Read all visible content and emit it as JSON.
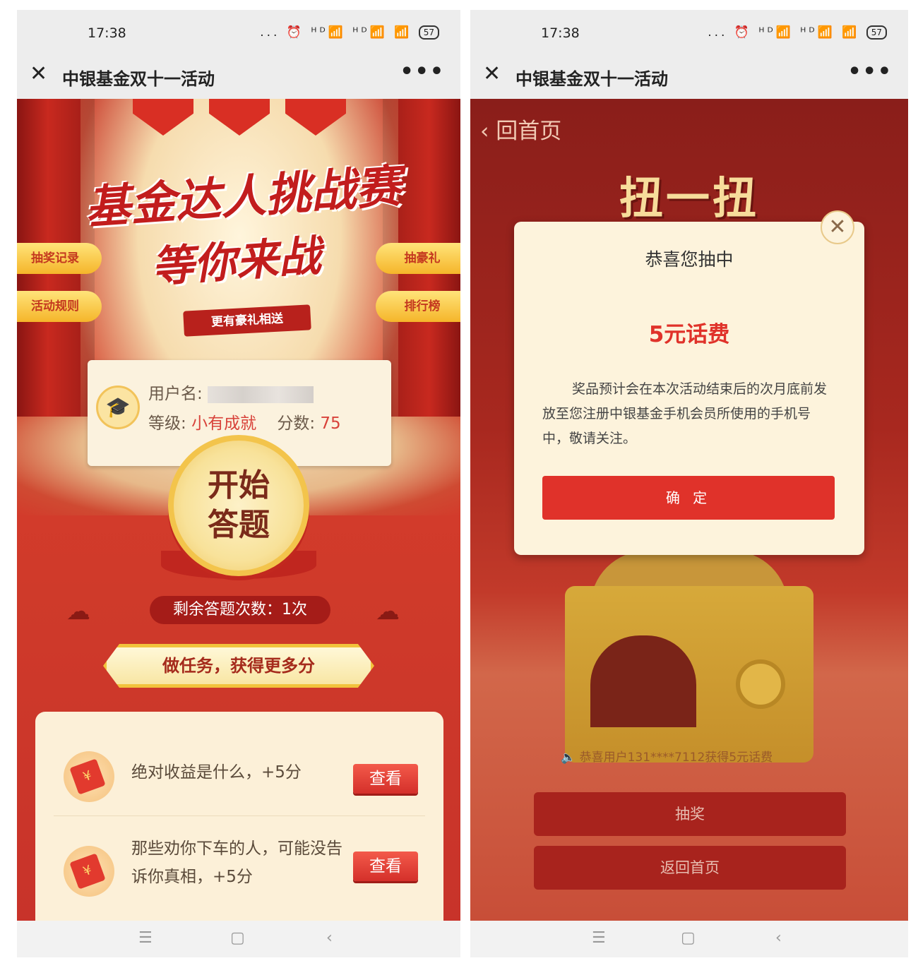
{
  "left": {
    "status": {
      "time": "17:38",
      "icons": "... ⏰ ᴴᴰ📶 ᴴᴰ📶 📶",
      "battery": "57"
    },
    "title": "中银基金双十一活动",
    "hero": {
      "headline1": "基金达人挑战赛",
      "headline2": "等你来战",
      "subbanner": "更有豪礼相送"
    },
    "side_buttons": {
      "lottery_record": "抽奖记录",
      "rules": "活动规则",
      "grand_prize": "抽豪礼",
      "ranking": "排行榜"
    },
    "user": {
      "name_label": "用户名:",
      "level_label": "等级:",
      "level_value": "小有成就",
      "score_label": "分数:",
      "score_value": "75"
    },
    "start_button": "开始答题",
    "remaining": "剩余答题次数：1次",
    "task_banner": "做任务，获得更多分",
    "tasks": [
      {
        "text": "绝对收益是什么，+5分",
        "button": "查看"
      },
      {
        "text": "那些劝你下车的人，可能没告诉你真相，+5分",
        "button": "查看"
      }
    ]
  },
  "right": {
    "status": {
      "time": "17:38",
      "icons": "... ⏰ ᴴᴰ📶 ᴴᴰ📶 📶",
      "battery": "57"
    },
    "title": "中银基金双十一活动",
    "back": "回首页",
    "twist_title": "扭一扭",
    "ticker": "恭喜用户131****7112获得5元话费",
    "draw_button": "抽奖",
    "home_button": "返回首页",
    "modal": {
      "title": "恭喜您抽中",
      "prize": "5元话费",
      "description": "奖品预计会在本次活动结束后的次月底前发放至您注册中银基金手机会员所使用的手机号中，敬请关注。",
      "confirm": "确 定"
    }
  },
  "icons": {
    "close": "close-icon",
    "more": "more-icon",
    "back": "chevron-left-icon",
    "speaker": "speaker-icon",
    "avatar": "graduate-avatar-icon",
    "red_envelope": "red-envelope-icon",
    "nav_menu": "menu-icon",
    "nav_home": "home-icon",
    "nav_back": "back-icon"
  },
  "colors": {
    "primary_red": "#e0322a",
    "gold": "#f3c44b",
    "cream": "#fdf3dc"
  }
}
